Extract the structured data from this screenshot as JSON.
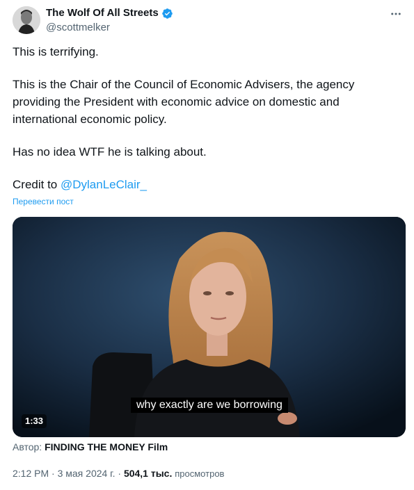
{
  "author": {
    "name": "The Wolf Of All Streets",
    "handle": "@scottmelker",
    "verified_color": "#1d9bf0"
  },
  "tweet": {
    "paragraphs": [
      "This is terrifying.",
      "This is the Chair of the Council of Economic Advisers, the agency providing the President with economic advice on domestic and international economic policy.",
      "Has no idea WTF he is talking about."
    ],
    "credit_prefix": "Credit to ",
    "credit_mention": "@DylanLeClair_",
    "translate_label": "Перевести пост"
  },
  "video": {
    "subtitle": "why exactly are we borrowing",
    "duration": "1:33",
    "source_prefix": "Автор: ",
    "source_name": "FINDING THE MONEY Film"
  },
  "meta": {
    "time": "2:12 PM",
    "date": "3 мая 2024 г.",
    "views_count": "504,1 тыс.",
    "views_label": "просмотров",
    "separator": "·"
  },
  "colors": {
    "link": "#1d9bf0",
    "secondary": "#536471",
    "text": "#0f1419"
  },
  "icons": {
    "more": "more-horizontal-icon",
    "verified": "verified-badge-icon"
  }
}
